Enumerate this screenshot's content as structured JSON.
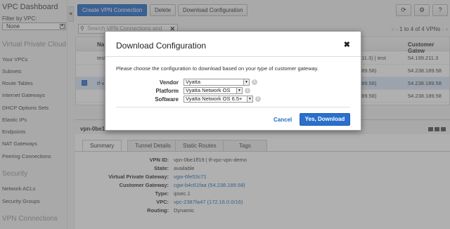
{
  "sidebar": {
    "title": "VPC Dashboard",
    "filter_label": "Filter by VPC:",
    "filter_value": "None",
    "section_vpc": "Virtual Private Cloud",
    "items_vpc": [
      "Your VPCs",
      "Subnets",
      "Route Tables",
      "Internet Gateways",
      "DHCP Options Sets",
      "Elastic IPs",
      "Endpoints",
      "NAT Gateways",
      "Peering Connections"
    ],
    "section_security": "Security",
    "items_security": [
      "Network ACLs",
      "Security Groups"
    ],
    "section_vpn": "VPN Connections"
  },
  "toolbar": {
    "create_label": "Create VPN Connection",
    "delete_label": "Delete",
    "download_label": "Download Configuration",
    "refresh_icon": "refresh-icon",
    "settings_icon": "gear-icon",
    "help_icon": "help-icon"
  },
  "search": {
    "placeholder": "Search VPN Connections and",
    "pager_text": "1 to 4 of 4 VPNs"
  },
  "table": {
    "columns": [
      "Na",
      "Customer Gatew"
    ],
    "rows": [
      {
        "name": "test",
        "middle": "211.3) | test",
        "ip": "54.199.211.3",
        "checked": false
      },
      {
        "name": "",
        "middle": "189.58)",
        "ip": "54.238.189.58",
        "checked": false
      },
      {
        "name": "tf-v",
        "middle": "189.58)",
        "ip": "54.238.189.58",
        "checked": true
      },
      {
        "name": "",
        "middle": "189.58)",
        "ip": "54.238.189.58",
        "checked": false
      }
    ]
  },
  "detail": {
    "title": "vpn-0be1",
    "tabs": [
      "Summary",
      "Tunnel Details",
      "Static Routes",
      "Tags"
    ],
    "fields": [
      {
        "label": "VPN ID:",
        "value": "vpn-0be1ff19 | tf-vpc-vpn-demo",
        "link": false
      },
      {
        "label": "State:",
        "value": "available",
        "link": false
      },
      {
        "label": "Virtual Private Gateway:",
        "value": "vgw-6fe53c71",
        "link": true
      },
      {
        "label": "Customer Gateway:",
        "value": "cgw-b4c61faa (54.238.189.58)",
        "link": true
      },
      {
        "label": "Type:",
        "value": "ipsec.1",
        "link": false
      },
      {
        "label": "VPC:",
        "value": "vpc-2387fa47 (172.16.0.0/16)",
        "link": true
      },
      {
        "label": "Routing:",
        "value": "Dynamic",
        "link": false
      }
    ]
  },
  "modal": {
    "title": "Download Configuration",
    "description": "Please choose the configuration to download based on your type of customer gateway.",
    "vendor_label": "Vendor",
    "vendor_value": "Vyatta",
    "platform_label": "Platform",
    "platform_value": "Vyatta Network OS",
    "software_label": "Software",
    "software_value": "Vyatta Network OS 6.5+",
    "cancel_label": "Cancel",
    "confirm_label": "Yes, Download",
    "close_glyph": "✖"
  },
  "colors": {
    "primary": "#2a6fcb",
    "link": "#1f6fbf",
    "selected_row": "#dbe7f7"
  }
}
